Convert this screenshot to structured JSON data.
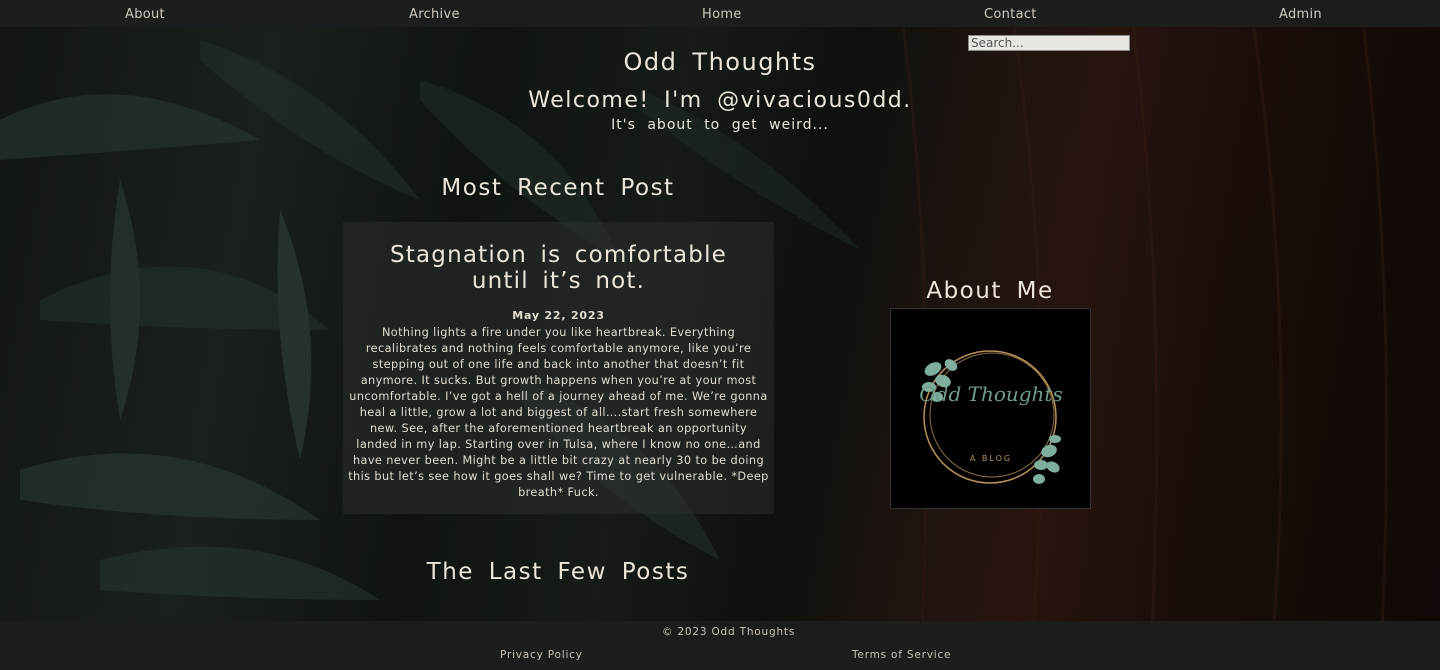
{
  "nav": {
    "items": [
      "About",
      "Archive",
      "Home",
      "Contact",
      "Admin"
    ]
  },
  "search": {
    "placeholder": "Search..."
  },
  "header": {
    "site_title": "Odd Thoughts",
    "welcome": "Welcome! I'm @vivacious0dd.",
    "tagline": "It's about to get weird..."
  },
  "recent": {
    "heading": "Most Recent Post",
    "post": {
      "title": "Stagnation is comfortable until it’s not.",
      "date": "May 22, 2023",
      "body": "Nothing lights a fire under you like heartbreak. Everything recalibrates and nothing feels comfortable anymore, like you’re stepping out of one life and back into another that doesn’t fit anymore. It sucks. But growth happens when you’re at your most uncomfortable. I’ve got a hell of a journey ahead of me. We’re gonna heal a little, grow a lot and biggest of all….start fresh somewhere new. See, after the aforementioned heartbreak an opportunity landed in my lap. Starting over in Tulsa, where I know no one…and have never been. Might be a little bit crazy at nearly 30 to be doing this but let’s see how it goes shall we? Time to get vulnerable. *Deep breath* Fuck."
    }
  },
  "last": {
    "heading": "The Last Few Posts"
  },
  "about": {
    "heading": "About Me",
    "logo_text": "Odd Thoughts",
    "logo_sub": "A BLOG"
  },
  "footer": {
    "copyright": "© 2023 Odd Thoughts",
    "privacy": "Privacy Policy",
    "terms": "Terms of Service"
  },
  "colors": {
    "nav_bg": "#1c1e1e",
    "text": "#ece6da",
    "leaf": "#6f9c8b",
    "gold": "#b8915a"
  }
}
